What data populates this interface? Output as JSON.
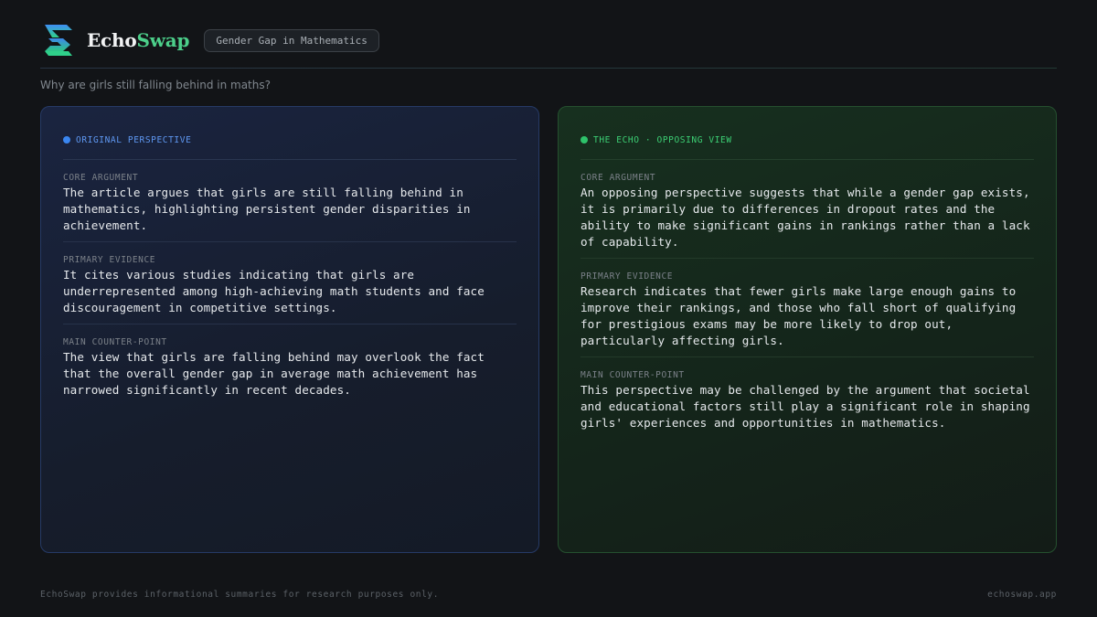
{
  "brand": {
    "part1": "Echo",
    "part2": "Swap",
    "logo_icon": "echoswap-logo-icon"
  },
  "topic_badge": "Gender Gap in Mathematics",
  "question": "Why are girls still falling behind in maths?",
  "colors": {
    "accent_green": "#4ccf8a",
    "original_blue": "#3a86f0",
    "echo_green": "#2ec26a"
  },
  "panels": {
    "original": {
      "label": "ORIGINAL PERSPECTIVE",
      "sections": [
        {
          "title": "CORE ARGUMENT",
          "text": "The article argues that girls are still falling behind in mathematics, highlighting persistent gender disparities in achievement."
        },
        {
          "title": "PRIMARY EVIDENCE",
          "text": "It cites various studies indicating that girls are underrepresented among high-achieving math students and face discouragement in competitive settings."
        },
        {
          "title": "MAIN COUNTER-POINT",
          "text": "The view that girls are falling behind may overlook the fact that the overall gender gap in average math achievement has narrowed significantly in recent decades."
        }
      ]
    },
    "echo": {
      "label": "THE ECHO · OPPOSING VIEW",
      "sections": [
        {
          "title": "CORE ARGUMENT",
          "text": "An opposing perspective suggests that while a gender gap exists, it is primarily due to differences in dropout rates and the ability to make significant gains in rankings rather than a lack of capability."
        },
        {
          "title": "PRIMARY EVIDENCE",
          "text": "Research indicates that fewer girls make large enough gains to improve their rankings, and those who fall short of qualifying for prestigious exams may be more likely to drop out, particularly affecting girls."
        },
        {
          "title": "MAIN COUNTER-POINT",
          "text": "This perspective may be challenged by the argument that societal and educational factors still play a significant role in shaping girls' experiences and opportunities in mathematics."
        }
      ]
    }
  },
  "footer": {
    "note": "EchoSwap provides informational summaries for research purposes only.",
    "url": "echoswap.app"
  }
}
